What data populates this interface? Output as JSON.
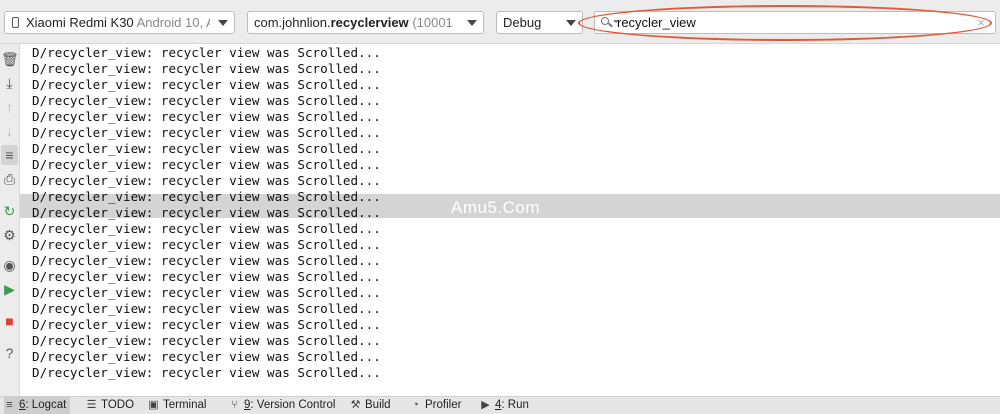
{
  "toolbar": {
    "device": {
      "name": "Xiaomi Redmi K30",
      "detail": "Android 10, A"
    },
    "process": {
      "prefix": "com.johnlion.",
      "bold": "recyclerview",
      "pid": "(10001"
    },
    "log_level": "Debug",
    "search": {
      "value": "recycler_view",
      "clear_glyph": "×"
    }
  },
  "sidebar": {
    "buttons": [
      {
        "name": "clear-logcat-icon",
        "glyph": "🗑"
      },
      {
        "name": "scroll-to-end-icon",
        "glyph": "⤓"
      },
      {
        "name": "up-arrow-icon",
        "glyph": "↑"
      },
      {
        "name": "down-arrow-icon",
        "glyph": "↓"
      },
      {
        "name": "soft-wrap-icon",
        "glyph": "≡"
      },
      {
        "name": "print-icon",
        "glyph": "⎙"
      },
      {
        "name": "restart-icon",
        "glyph": "↻"
      },
      {
        "name": "settings-icon",
        "glyph": "⚙"
      },
      {
        "name": "screen-capture-icon",
        "glyph": "◉"
      },
      {
        "name": "screen-record-icon",
        "glyph": "▶"
      },
      {
        "name": "stop-icon",
        "glyph": "■"
      },
      {
        "name": "help-icon",
        "glyph": "?"
      }
    ]
  },
  "log": {
    "lines": [
      "D/recycler_view: recycler view was Scrolled...",
      "D/recycler_view: recycler view was Scrolled...",
      "D/recycler_view: recycler view was Scrolled...",
      "D/recycler_view: recycler view was Scrolled...",
      "D/recycler_view: recycler view was Scrolled...",
      "D/recycler_view: recycler view was Scrolled...",
      "D/recycler_view: recycler view was Scrolled...",
      "D/recycler_view: recycler view was Scrolled...",
      "D/recycler_view: recycler view was Scrolled...",
      "D/recycler_view: recycler view was Scrolled...",
      "D/recycler_view: recycler view was Scrolled...",
      "D/recycler_view: recycler view was Scrolled...",
      "D/recycler_view: recycler view was Scrolled...",
      "D/recycler_view: recycler view was Scrolled...",
      "D/recycler_view: recycler view was Scrolled...",
      "D/recycler_view: recycler view was Scrolled...",
      "D/recycler_view: recycler view was Scrolled...",
      "D/recycler_view: recycler view was Scrolled...",
      "D/recycler_view: recycler view was Scrolled...",
      "D/recycler_view: recycler view was Scrolled...",
      "D/recycler_view: recycler view was Scrolled..."
    ]
  },
  "watermark": "Amu5.Com",
  "statusbar": {
    "tabs": [
      {
        "key": "6",
        "label": ": Logcat",
        "icon": "≡"
      },
      {
        "key": "",
        "label": "TODO",
        "icon": "☰"
      },
      {
        "key": "",
        "label": "Terminal",
        "icon": "▣"
      },
      {
        "key": "9",
        "label": ": Version Control",
        "icon": "⑂"
      },
      {
        "key": "",
        "label": "Build",
        "icon": "⚒"
      },
      {
        "key": "",
        "label": "Profiler",
        "icon": "◔"
      },
      {
        "key": "4",
        "label": ": Run",
        "icon": "▶"
      }
    ]
  }
}
